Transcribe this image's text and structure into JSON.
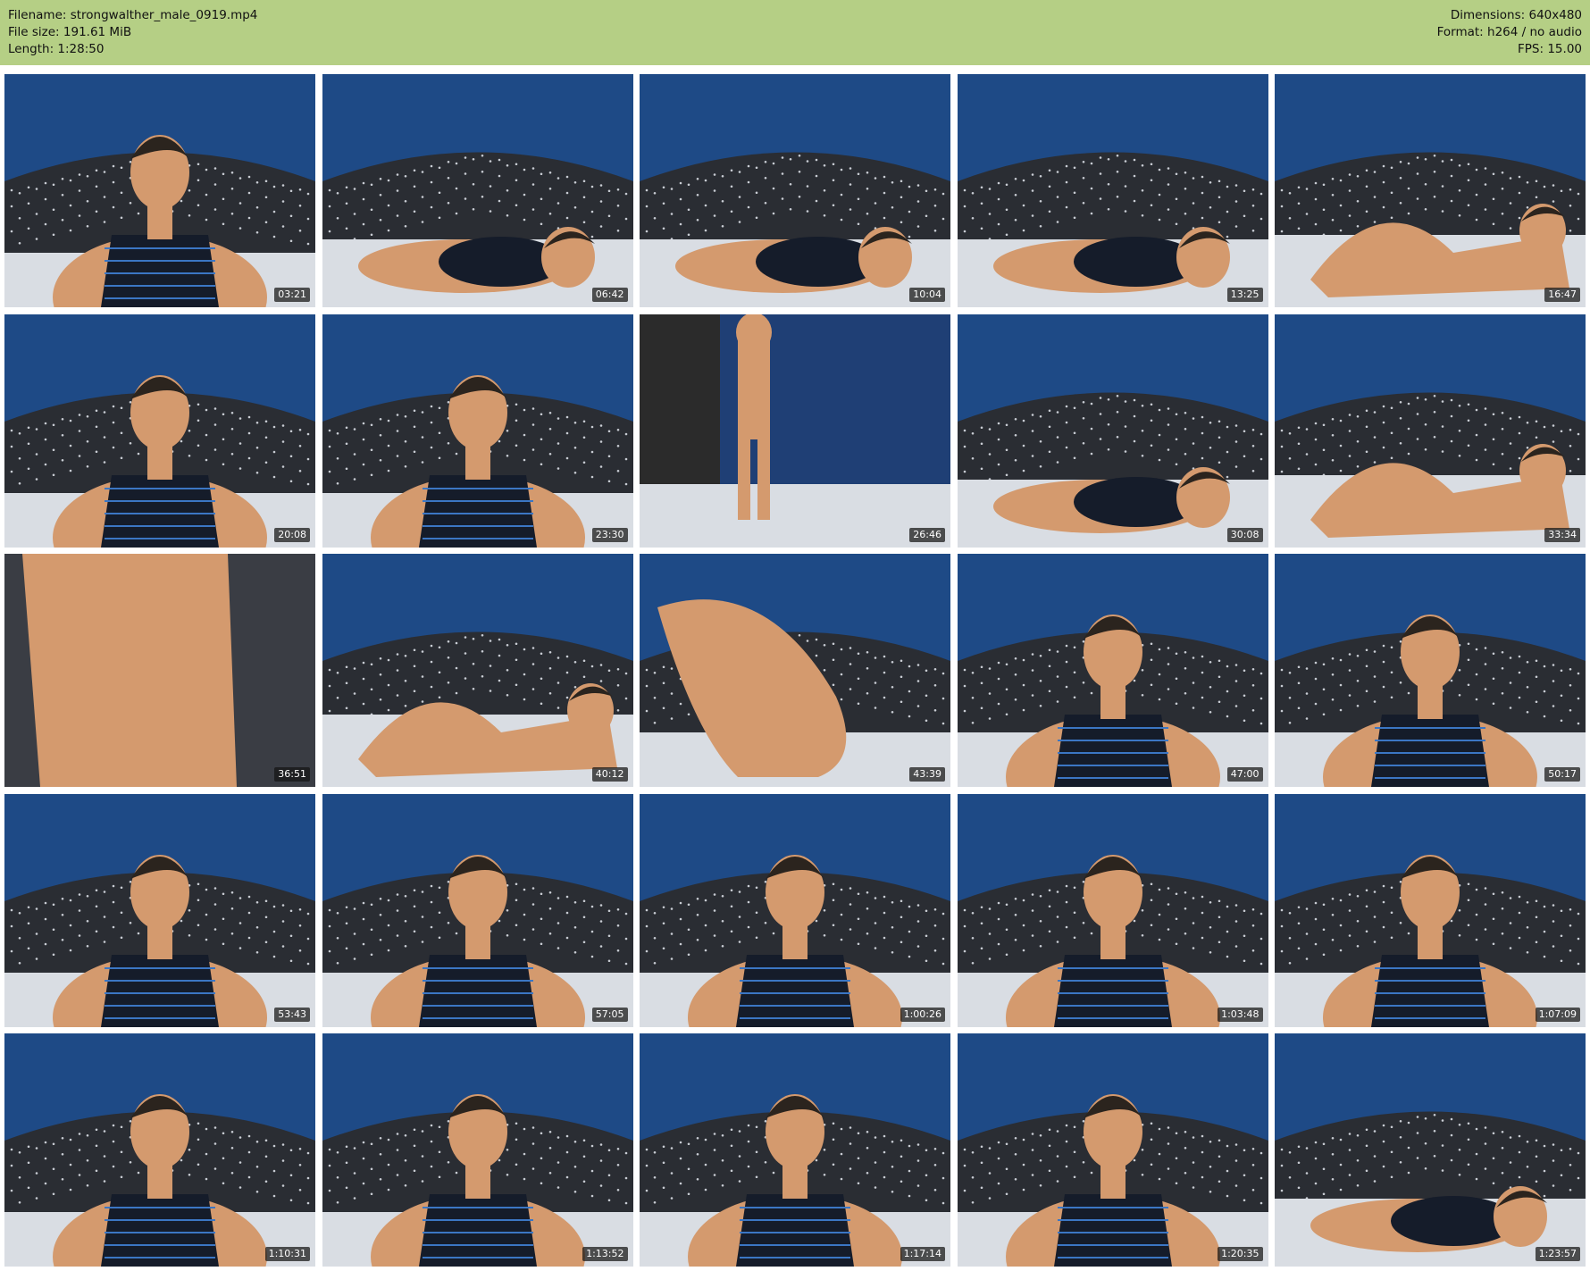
{
  "header": {
    "filename": "Filename: strongwalther_male_0919.mp4",
    "file_size": "File size: 191.61 MiB",
    "length": "Length: 1:28:50",
    "dimensions": "Dimensions: 640x480",
    "format": "Format: h264 / no audio",
    "fps": "FPS: 15.00"
  },
  "colors": {
    "header_bg": "#b5cf85",
    "wall_blue": "#1e4a86",
    "headboard": "#2a2d33",
    "sheets": "#d9dde3",
    "skin": "#d49a6e"
  },
  "thumbnails": [
    {
      "timestamp": "03:21",
      "scene": "portrait"
    },
    {
      "timestamp": "06:42",
      "scene": "lying"
    },
    {
      "timestamp": "10:04",
      "scene": "lying"
    },
    {
      "timestamp": "13:25",
      "scene": "lying"
    },
    {
      "timestamp": "16:47",
      "scene": "reclining"
    },
    {
      "timestamp": "20:08",
      "scene": "portrait"
    },
    {
      "timestamp": "23:30",
      "scene": "portrait"
    },
    {
      "timestamp": "26:46",
      "scene": "standing"
    },
    {
      "timestamp": "30:08",
      "scene": "lying"
    },
    {
      "timestamp": "33:34",
      "scene": "reclining"
    },
    {
      "timestamp": "36:51",
      "scene": "closeup"
    },
    {
      "timestamp": "40:12",
      "scene": "reclining"
    },
    {
      "timestamp": "43:39",
      "scene": "kneeling"
    },
    {
      "timestamp": "47:00",
      "scene": "portrait"
    },
    {
      "timestamp": "50:17",
      "scene": "portrait"
    },
    {
      "timestamp": "53:43",
      "scene": "portrait"
    },
    {
      "timestamp": "57:05",
      "scene": "portrait"
    },
    {
      "timestamp": "1:00:26",
      "scene": "portrait"
    },
    {
      "timestamp": "1:03:48",
      "scene": "portrait"
    },
    {
      "timestamp": "1:07:09",
      "scene": "portrait"
    },
    {
      "timestamp": "1:10:31",
      "scene": "portrait"
    },
    {
      "timestamp": "1:13:52",
      "scene": "portrait"
    },
    {
      "timestamp": "1:17:14",
      "scene": "portrait"
    },
    {
      "timestamp": "1:20:35",
      "scene": "portrait"
    },
    {
      "timestamp": "1:23:57",
      "scene": "lying"
    }
  ]
}
